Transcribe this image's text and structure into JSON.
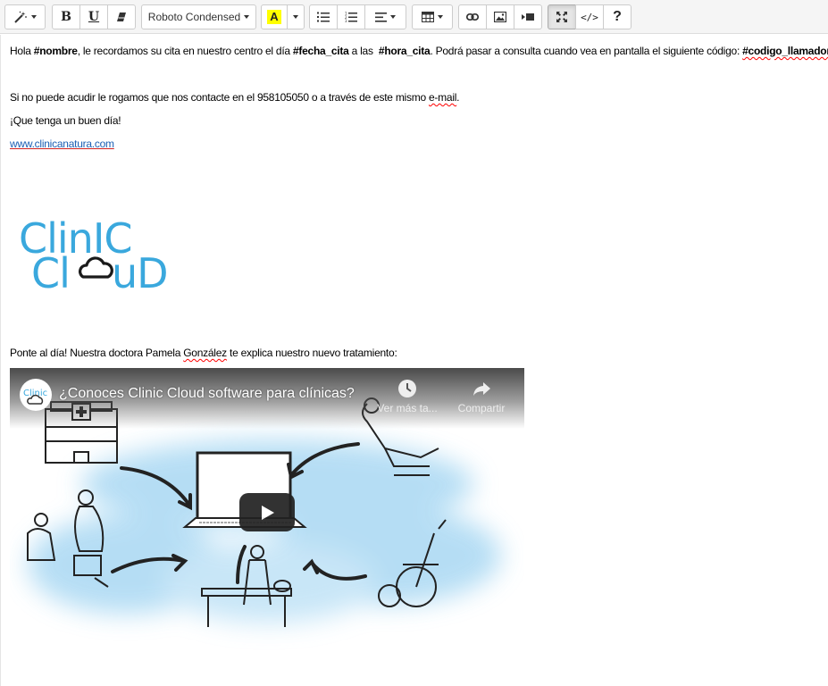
{
  "toolbar": {
    "font_name": "Roboto Condensed",
    "highlight_letter": "A",
    "highlight_color": "#ffff00",
    "bold_label": "B",
    "underline_label": "U",
    "code_label": "</>",
    "help_label": "?"
  },
  "editor": {
    "line1": {
      "t1": "Hola ",
      "b1": "#nombre",
      "t2": ", le recordamos su cita en nuestro centro el día ",
      "b2": "#fecha_cita",
      "t3": " a las  ",
      "b3": "#hora_cita",
      "t4": ". Podrá pasar a consulta cuando vea en pantalla el siguiente código: ",
      "b4": "#codigo_llamador."
    },
    "line2": {
      "t1": "Si no puede acudir le rogamos que nos contacte en el 958105050 o a través de este mismo ",
      "t2": "e-mail",
      "t3": "."
    },
    "line3": "¡Que tenga un buen día!",
    "link": "www.clinicanatura.com",
    "logo": {
      "top_word": "ClinIC",
      "bottom_word": "ClouD",
      "color": "#3aa8dd"
    },
    "line4": {
      "t1": "Ponte al día! Nuestra doctora Pamela ",
      "t2": "González",
      "t3": " te explica nuestro nuevo tratamiento:"
    },
    "video": {
      "title": "¿Conoces Clinic Cloud software para clínicas?",
      "watch_later": "Ver más ta...",
      "share": "Compartir",
      "channel_icon_text": "Clinic"
    }
  }
}
